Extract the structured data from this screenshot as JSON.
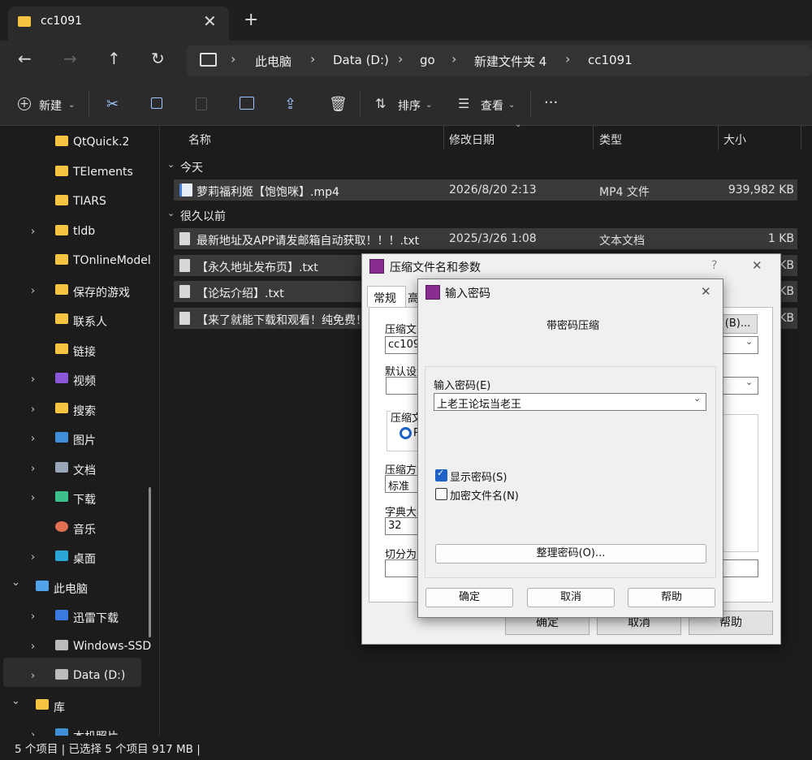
{
  "tab": {
    "title": "cc1091",
    "close": "✕",
    "add": "+"
  },
  "nav": {
    "back": "←",
    "forward": "→",
    "up": "↑",
    "refresh": "↻"
  },
  "breadcrumb": [
    "此电脑",
    "Data (D:)",
    "go",
    "新建文件夹 4",
    "cc1091"
  ],
  "breadcrumb_sep": "›",
  "toolbar": {
    "new": "新建",
    "sort": "排序",
    "view": "查看",
    "more": "···"
  },
  "sidebar": [
    {
      "label": "QtQuick.2",
      "icon": "folder-icon",
      "expand": false,
      "indent": 1
    },
    {
      "label": "TElements",
      "icon": "folder-icon",
      "expand": false,
      "indent": 1
    },
    {
      "label": "TIARS",
      "icon": "folder-icon",
      "expand": false,
      "indent": 1
    },
    {
      "label": "tldb",
      "icon": "folder-icon",
      "expand": true,
      "indent": 1
    },
    {
      "label": "TOnlineModel",
      "icon": "folder-icon",
      "expand": false,
      "indent": 1
    },
    {
      "label": "保存的游戏",
      "icon": "folder-icon",
      "expand": true,
      "indent": 1
    },
    {
      "label": "联系人",
      "icon": "folder-icon",
      "expand": false,
      "indent": 1
    },
    {
      "label": "链接",
      "icon": "folder-icon",
      "expand": false,
      "indent": 1
    },
    {
      "label": "视频",
      "icon": "video-icon",
      "expand": true,
      "indent": 1
    },
    {
      "label": "搜索",
      "icon": "folder-icon",
      "expand": true,
      "indent": 1
    },
    {
      "label": "图片",
      "icon": "picture-icon",
      "expand": true,
      "indent": 1
    },
    {
      "label": "文档",
      "icon": "document-icon",
      "expand": true,
      "indent": 1
    },
    {
      "label": "下载",
      "icon": "download-icon",
      "expand": true,
      "indent": 1
    },
    {
      "label": "音乐",
      "icon": "music-icon",
      "expand": false,
      "indent": 1
    },
    {
      "label": "桌面",
      "icon": "desktop-icon",
      "expand": true,
      "indent": 1
    },
    {
      "label": "此电脑",
      "icon": "pc-icon",
      "expand": "open",
      "indent": 0
    },
    {
      "label": "迅雷下载",
      "icon": "thunder-icon",
      "expand": true,
      "indent": 1
    },
    {
      "label": "Windows-SSD",
      "icon": "drive-icon",
      "expand": true,
      "indent": 1
    },
    {
      "label": "Data (D:)",
      "icon": "drive-icon",
      "expand": true,
      "indent": 1
    },
    {
      "label": "库",
      "icon": "folder-icon",
      "expand": "open",
      "indent": 0
    },
    {
      "label": "本机照片",
      "icon": "picture-icon",
      "expand": true,
      "indent": 1
    }
  ],
  "columns": {
    "name": "名称",
    "date": "修改日期",
    "type": "类型",
    "size": "大小"
  },
  "groups": {
    "today": "今天",
    "long_ago": "很久以前"
  },
  "files": [
    {
      "name": "萝莉福利姬【饱饱咪】.mp4",
      "date": "2026/8/20 2:13",
      "type": "MP4 文件",
      "size": "939,982 KB",
      "icon": "video-file-icon"
    },
    {
      "name": "最新地址及APP请发邮箱自动获取！！！.txt",
      "date": "2025/3/26 1:08",
      "type": "文本文档",
      "size": "1 KB",
      "icon": "text-file-icon"
    },
    {
      "name": "【永久地址发布页】.txt",
      "date": "",
      "type": "",
      "size": "KB",
      "icon": "text-file-icon"
    },
    {
      "name": "【论坛介绍】.txt",
      "date": "",
      "type": "",
      "size": "KB",
      "icon": "text-file-icon"
    },
    {
      "name": "【来了就能下载和观看！纯免费！",
      "date": "",
      "type": "",
      "size": "KB",
      "icon": "text-file-icon"
    }
  ],
  "status": "5 个项目  |  已选择 5 个项目  917 MB  |",
  "dialog_compress": {
    "title": "压缩文件名和参数",
    "help": "?",
    "close": "✕",
    "tab_general": "常规",
    "tab_adv": "高",
    "archive_label": "压缩文",
    "archive_value": "cc1091",
    "browse": "(B)...",
    "default_label": "默认设置",
    "format_label": "压缩文",
    "format_opt": "R",
    "method_label": "压缩方式",
    "method_value": "标准",
    "dict_label": "字典大小",
    "dict_value": "32",
    "split_label": "切分为分",
    "ok": "确定",
    "cancel": "取消",
    "help_btn": "帮助"
  },
  "dialog_password": {
    "title": "输入密码",
    "close": "✕",
    "heading": "带密码压缩",
    "enter_label": "输入密码(E)",
    "password_value": "上老王论坛当老王",
    "show_password": "显示密码(S)",
    "show_checked": true,
    "encrypt_names": "加密文件名(N)",
    "encrypt_checked": false,
    "organize": "整理密码(O)...",
    "ok": "确定",
    "cancel": "取消",
    "help": "帮助"
  }
}
